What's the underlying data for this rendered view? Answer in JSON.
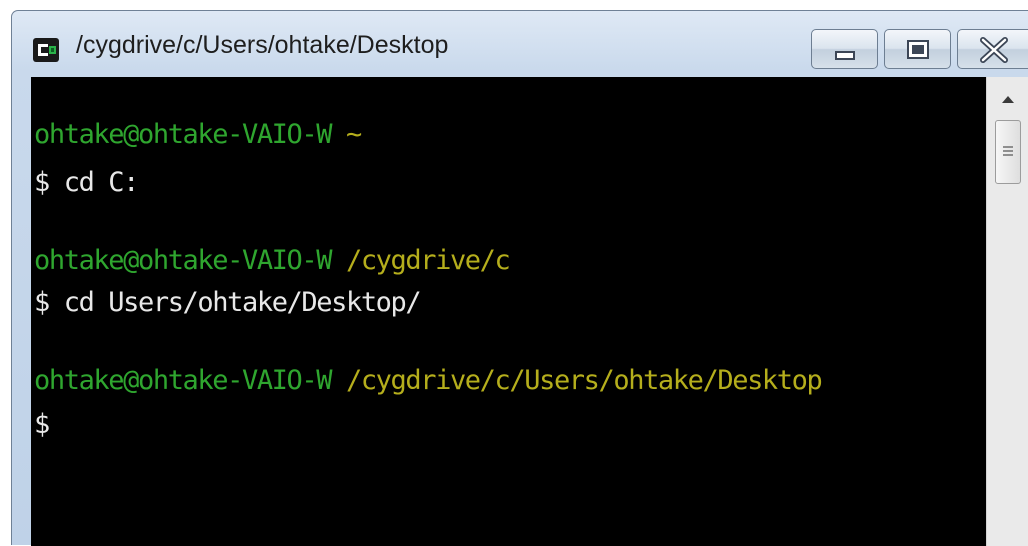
{
  "window": {
    "title": "/cygdrive/c/Users/ohtake/Desktop",
    "controls": {
      "minimize_icon": "minimize-icon",
      "maximize_icon": "maximize-icon",
      "close_icon": "close-icon"
    }
  },
  "terminal": {
    "background": "#000000",
    "colors": {
      "user": "#2fa62f",
      "path": "#b5ae1c",
      "text": "#e8e8e8"
    },
    "lines": [
      {
        "user": "ohtake@ohtake-VAIO-W",
        "path": "~"
      },
      {
        "prompt": "$",
        "command": "cd C:"
      },
      {
        "user": "ohtake@ohtake-VAIO-W",
        "path": "/cygdrive/c"
      },
      {
        "prompt": "$",
        "command": "cd Users/ohtake/Desktop/"
      },
      {
        "user": "ohtake@ohtake-VAIO-W",
        "path": "/cygdrive/c/Users/ohtake/Desktop"
      },
      {
        "prompt": "$",
        "command": ""
      }
    ]
  },
  "scrollbar": {
    "up_icon": "arrow-up-icon",
    "thumb_grip_icon": "grip-icon"
  }
}
